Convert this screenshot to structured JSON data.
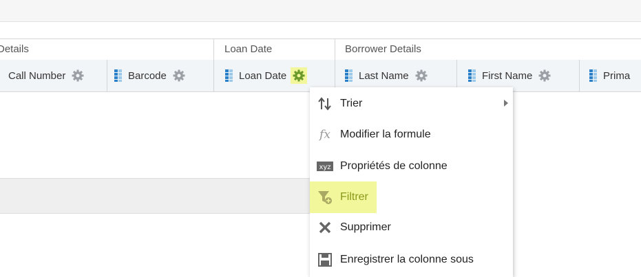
{
  "group_headers": {
    "details": "Details",
    "loan_date": "Loan Date",
    "borrower_details": "Borrower Details"
  },
  "columns": [
    {
      "label": "Call Number"
    },
    {
      "label": "Barcode"
    },
    {
      "label": "Loan Date"
    },
    {
      "label": "Last Name"
    },
    {
      "label": "First Name"
    },
    {
      "label": "Prima"
    }
  ],
  "context_menu": {
    "sort": "Trier",
    "edit_formula": "Modifier la formule",
    "column_properties": "Propriétés de colonne",
    "filter": "Filtrer",
    "delete": "Supprimer",
    "save_column_as": "Enregistrer la colonne sous",
    "icons": {
      "sort": "sort-arrows-icon",
      "edit_formula": "fx-icon",
      "column_properties": "xyz-icon",
      "filter": "filter-plus-icon",
      "delete": "x-icon",
      "save_column_as": "save-icon"
    }
  },
  "colors": {
    "highlight": "#f1f79a",
    "gear": "#9aa0a6",
    "column_icon": "#2a7fc9"
  }
}
